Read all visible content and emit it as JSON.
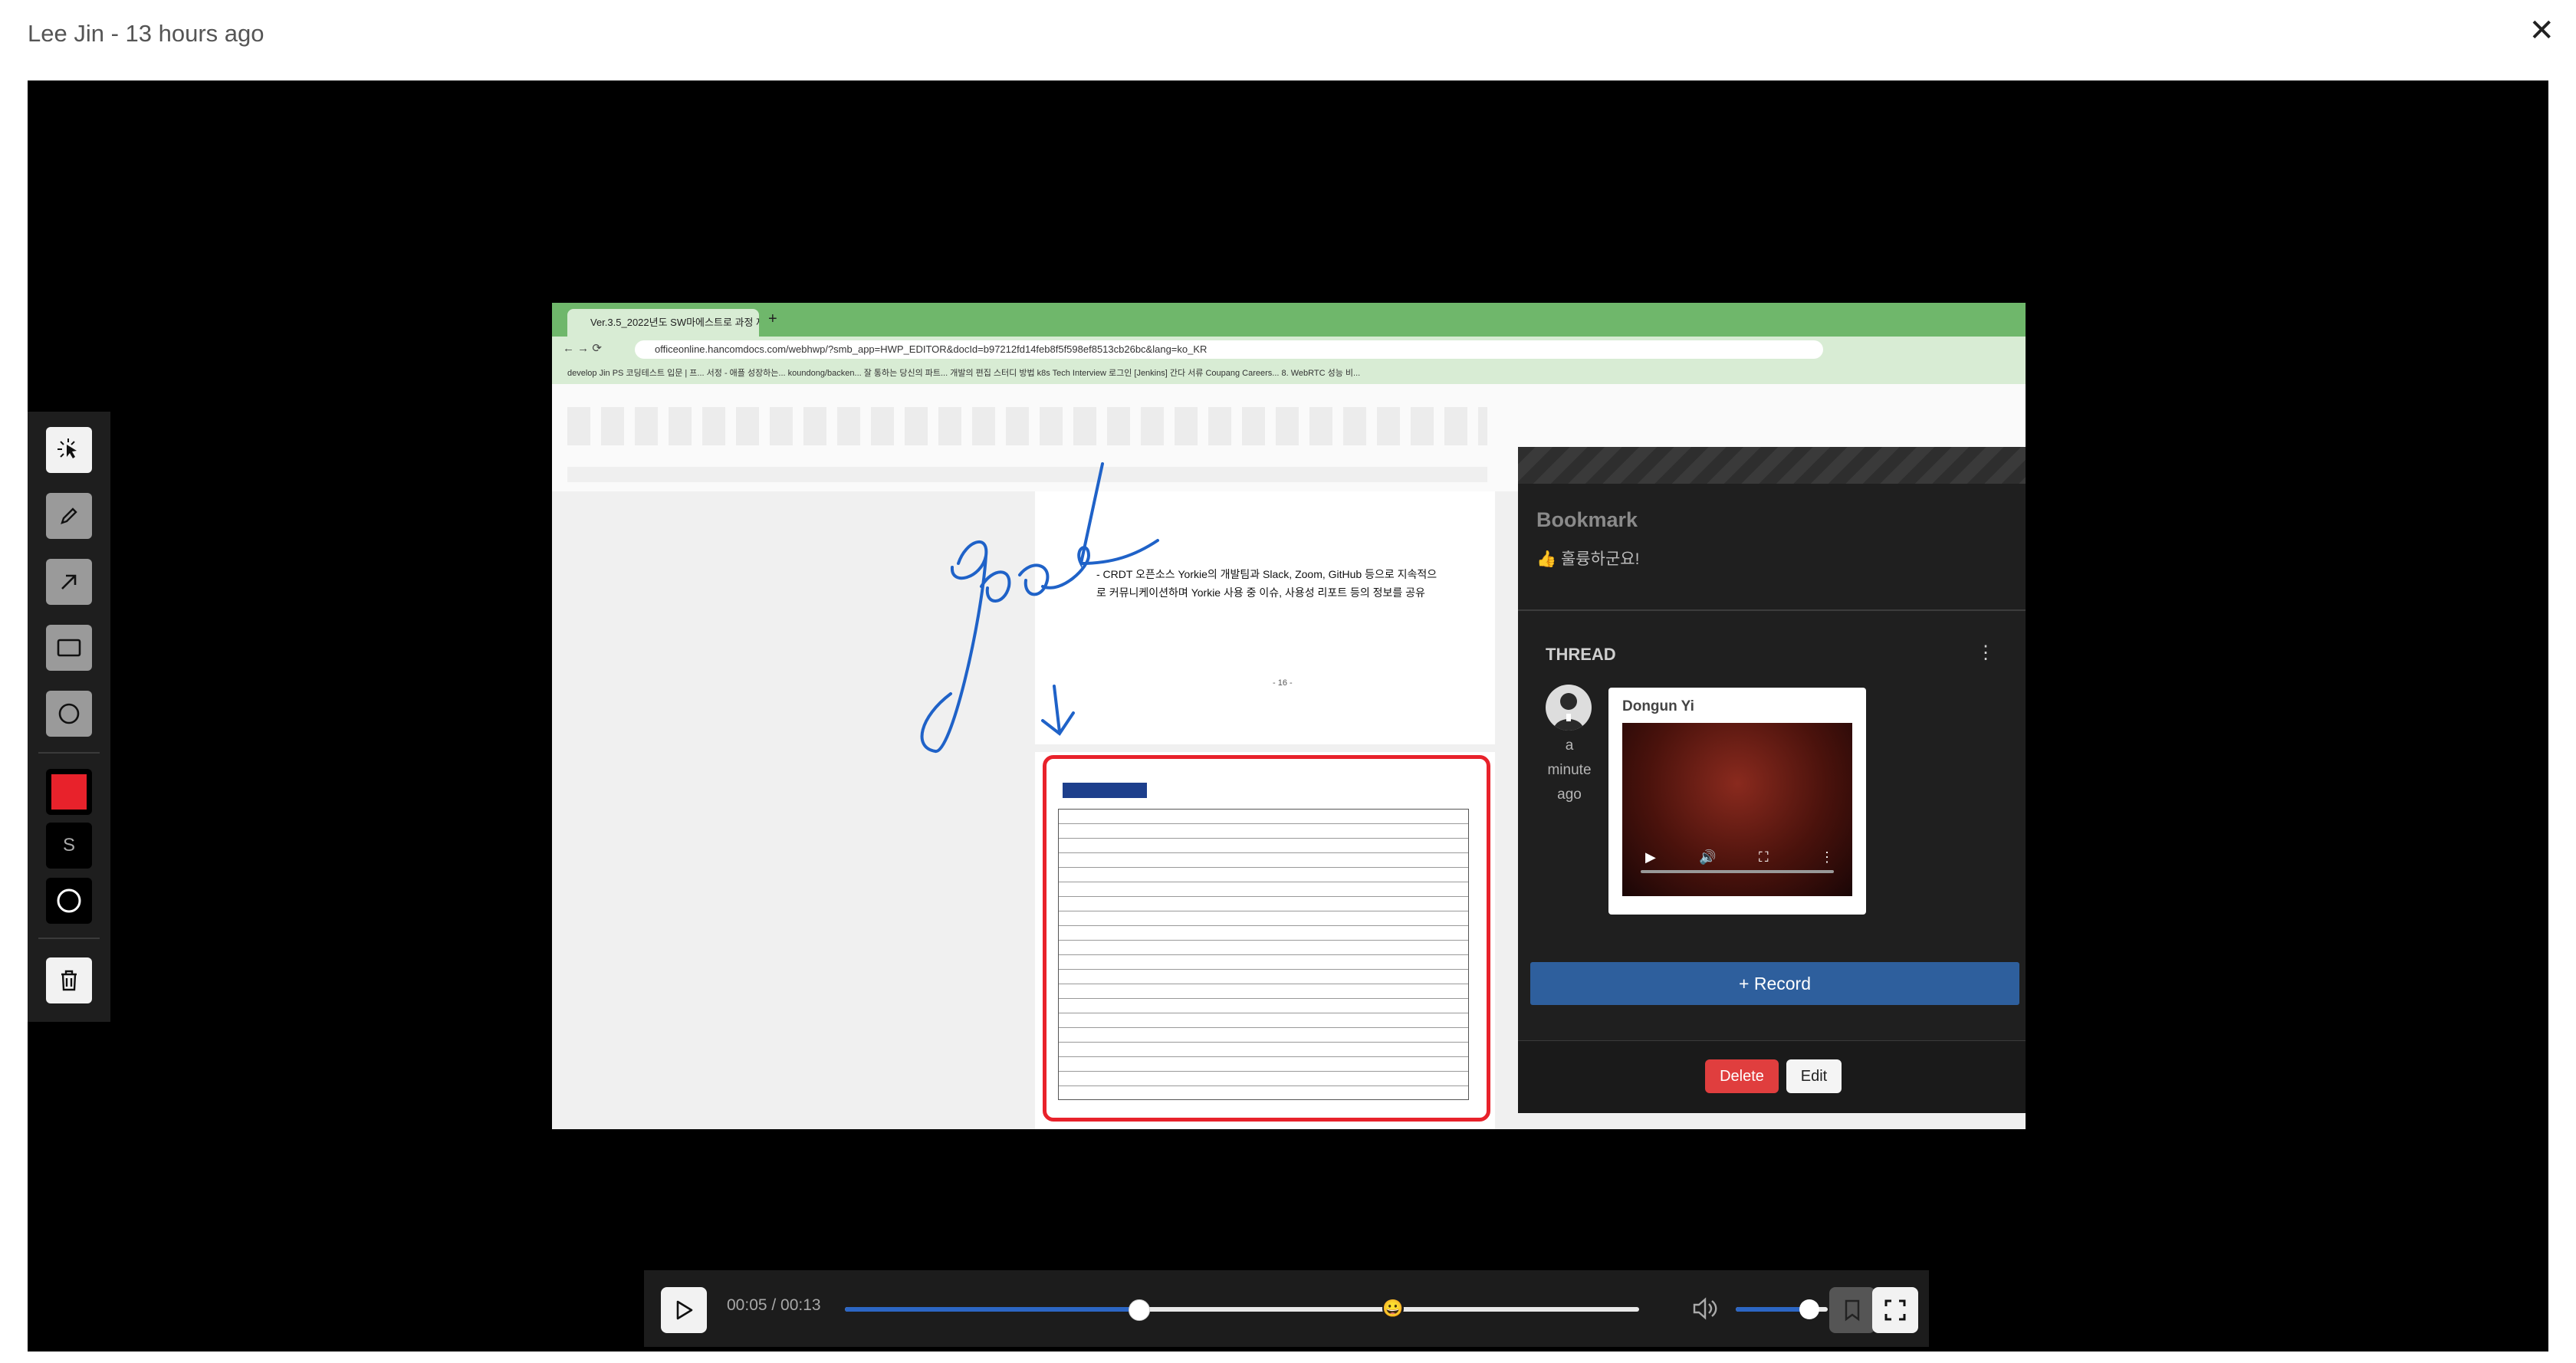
{
  "header": {
    "title": "Lee Jin - 13 hours ago",
    "close_icon": "close-icon"
  },
  "toolbar": {
    "tools": [
      "select-tool-icon",
      "pencil-icon",
      "arrow-icon",
      "rectangle-icon",
      "circle-icon"
    ],
    "color": "#e8222b",
    "size_label": "S",
    "delete_icon": "trash-icon"
  },
  "screenshot": {
    "tab_title": "Ver.3.5_2022년도 SW마에스트로 과정 제1...",
    "url": "officeonline.hancomdocs.com/webhwp/?smb_app=HWP_EDITOR&docId=b97212fd14feb8f5f598ef8513cb26bc&lang=ko_KR",
    "bookmarks": "develop   Jin   PS   코딩테스트 입문 | 프...   서정 - 애플 성장하는...   koundong/backen...   잘 통하는 당신의 파트...   개발의 편집 스터디 방법   k8s   Tech Interview   로그인 [Jenkins]   간다   서류   Coupang Careers...   8. WebRTC 성능 비...",
    "doc_line1": "- CRDT 오픈소스 Yorkie의 개발팀과 Slack, Zoom, GitHub 등으로 지속적으",
    "doc_line2": "로 커뮤니케이션하며 Yorkie 사용 중 이슈, 사용성 리포트 등의 정보를 공유",
    "page_number": "- 16 -",
    "handwriting": "good"
  },
  "bookmark_panel": {
    "title": "Bookmark",
    "description": "👍 훌륭하군요!",
    "thread_label": "THREAD",
    "comment": {
      "author": "Dongun Yi",
      "time": "a minute ago"
    },
    "record_label": "+ Record",
    "delete_label": "Delete",
    "edit_label": "Edit"
  },
  "player": {
    "time": "00:05 / 00:13",
    "progress": 0.37,
    "bookmark_marker": 0.69,
    "volume": 0.8,
    "marker_emoji": "😀"
  }
}
